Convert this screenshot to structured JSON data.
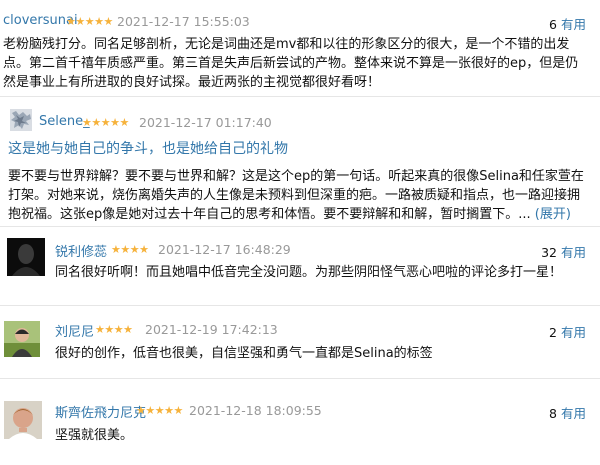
{
  "reviews": [
    {
      "username": "cloversunai",
      "stars": "★★★★★",
      "date": "2021-12-17 15:55:03",
      "votes": "6",
      "votes_label": "有用",
      "body": "老粉脑残打分。同名足够剖析，无论是词曲还是mv都和以往的形象区分的很大，是一个不错的出发点。第二首千禧年质感严重。第三首是失声后新尝试的产物。整体来说不算是一张很好的ep，但是仍然是事业上有所进取的良好试探。最近两张的主视觉都很好看呀！"
    },
    {
      "username": "Selene_",
      "stars": "★★★★★",
      "date": "2021-12-17 01:17:40",
      "title": "这是她与她自己的争斗，也是她给自己的礼物",
      "body": "要不要与世界辩解？要不要与世界和解？这是这个ep的第一句话。听起来真的很像Selina和任家萱在打架。对她来说，烧伤离婚失声的人生像是未预料到但深重的疤。一路被质疑和指点，也一路迎接拥抱祝福。这张ep像是她对过去十年自己的思考和体悟。要不要辩解和和解，暂时搁置下。...",
      "expand_label": "(展开)"
    },
    {
      "username": "锐利修蕊",
      "stars": "★★★★",
      "date": "2021-12-17 16:48:29",
      "votes": "32",
      "votes_label": "有用",
      "body": "同名很好听啊！而且她唱中低音完全没问题。为那些阴阳怪气恶心吧啦的评论多打一星！"
    },
    {
      "username": "刘尼尼",
      "stars": "★★★★",
      "date": "2021-12-19 17:42:13",
      "votes": "2",
      "votes_label": "有用",
      "body": "很好的创作，低音也很美，自信坚强和勇气一直都是Selina的标签"
    },
    {
      "username": "斯齊佐飛力尼克",
      "stars": "★★★★★",
      "date": "2021-12-18 18:09:55",
      "votes": "8",
      "votes_label": "有用",
      "body": "坚强就很美。"
    }
  ],
  "colors": {
    "link": "#3377aa",
    "star": "#f6b23b",
    "meta": "#999999"
  },
  "icons": {
    "avatar": "user-avatar-photo"
  }
}
